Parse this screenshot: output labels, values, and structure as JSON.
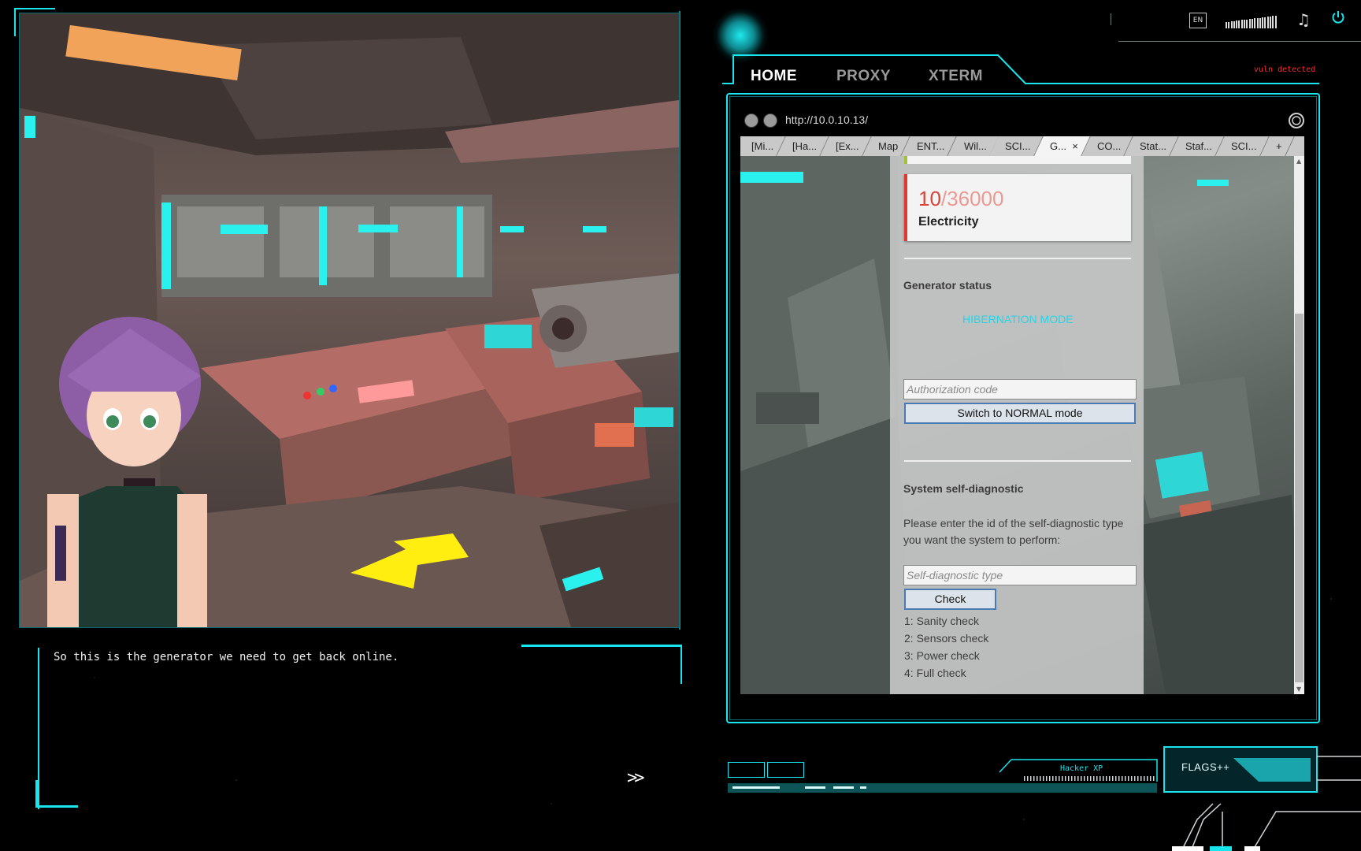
{
  "scene": {
    "dialog_text": "So this is the generator we need to get back online.",
    "next_label": ">>"
  },
  "topbar": {
    "language": "EN",
    "vuln_label": "vuln detected"
  },
  "nav": {
    "tabs": [
      {
        "label": "HOME",
        "active": true
      },
      {
        "label": "PROXY",
        "active": false
      },
      {
        "label": "XTERM",
        "active": false
      }
    ]
  },
  "browser": {
    "url": "http://10.0.10.13/",
    "tabs": [
      {
        "label": "[Mi...",
        "active": false
      },
      {
        "label": "[Ha...",
        "active": false
      },
      {
        "label": "[Ex...",
        "active": false
      },
      {
        "label": "Map",
        "active": false
      },
      {
        "label": "ENT...",
        "active": false
      },
      {
        "label": "Wil...",
        "active": false
      },
      {
        "label": "SCI...",
        "active": false
      },
      {
        "label": "G...",
        "active": true
      },
      {
        "label": "CO...",
        "active": false
      },
      {
        "label": "Stat...",
        "active": false
      },
      {
        "label": "Staf...",
        "active": false
      },
      {
        "label": "SCI...",
        "active": false
      }
    ],
    "new_tab_label": "+",
    "close_symbol": "×",
    "page": {
      "electricity": {
        "value": "10",
        "max": "/36000",
        "label": "Electricity"
      },
      "generator_status_heading": "Generator status",
      "generator_status_value": "HIBERNATION MODE",
      "auth_placeholder": "Authorization code",
      "switch_button": "Switch to NORMAL mode",
      "diagnostic_heading": "System self-diagnostic",
      "diagnostic_prompt": "Please enter the id of the self-diagnostic type you want the system to perform:",
      "diagnostic_placeholder": "Self-diagnostic type",
      "check_button": "Check",
      "options": [
        "1: Sanity check",
        "2: Sensors check",
        "3: Power check",
        "4: Full check"
      ]
    }
  },
  "hud": {
    "hacker_xp_label": "Hacker XP",
    "flags_label": "FLAGS++"
  },
  "colors": {
    "accent": "#18e6ee",
    "alert": "#ff2a2a",
    "status_cyan": "#29d3e6",
    "card_accent": "#e03a2f"
  }
}
